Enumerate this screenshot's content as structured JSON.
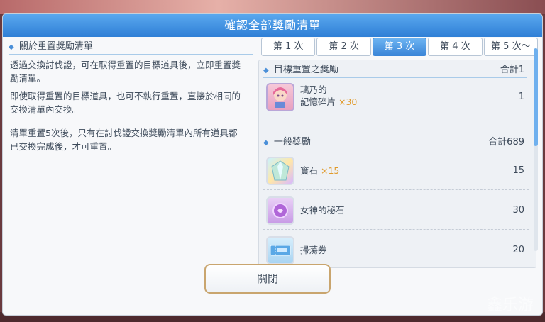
{
  "dialog": {
    "title": "確認全部獎勵清單",
    "close_label": "關閉"
  },
  "left": {
    "header": "關於重置獎勵清單",
    "paragraphs": [
      "透過交換討伐證，可在取得重置的目標道具後，立即重置獎勵清單。",
      "即使取得重置的目標道具，也可不執行重置，直接於相同的交換清單內交換。",
      "清單重置5次後，只有在討伐證交換獎勵清單內所有道具都已交換完成後，才可重置。"
    ]
  },
  "tabs": [
    "第 1 次",
    "第 2 次",
    "第 3 次",
    "第 4 次",
    "第 5 次〜"
  ],
  "active_tab": 2,
  "target_section": {
    "title": "目標重置之獎勵",
    "total": "合計1",
    "items": [
      {
        "name_line1": "璃乃的",
        "name_line2": "記憶碎片",
        "qty": "×30",
        "count": "1",
        "icon": "character-portrait-icon"
      }
    ]
  },
  "general_section": {
    "title": "一般獎勵",
    "total": "合計689",
    "items": [
      {
        "name": "寶石",
        "qty": "×15",
        "count": "15",
        "icon": "gem-icon"
      },
      {
        "name": "女神的秘石",
        "qty": "",
        "count": "30",
        "icon": "goddess-stone-icon"
      },
      {
        "name": "掃蕩券",
        "qty": "",
        "count": "20",
        "icon": "sweep-ticket-icon"
      }
    ]
  },
  "scroll": {
    "position_fraction": 0.0
  },
  "watermark": "鑫乐游",
  "colors": {
    "title_bar": "#3b8ee0",
    "accent_qty": "#e09a2a",
    "active_tab": "#4a94e0"
  }
}
